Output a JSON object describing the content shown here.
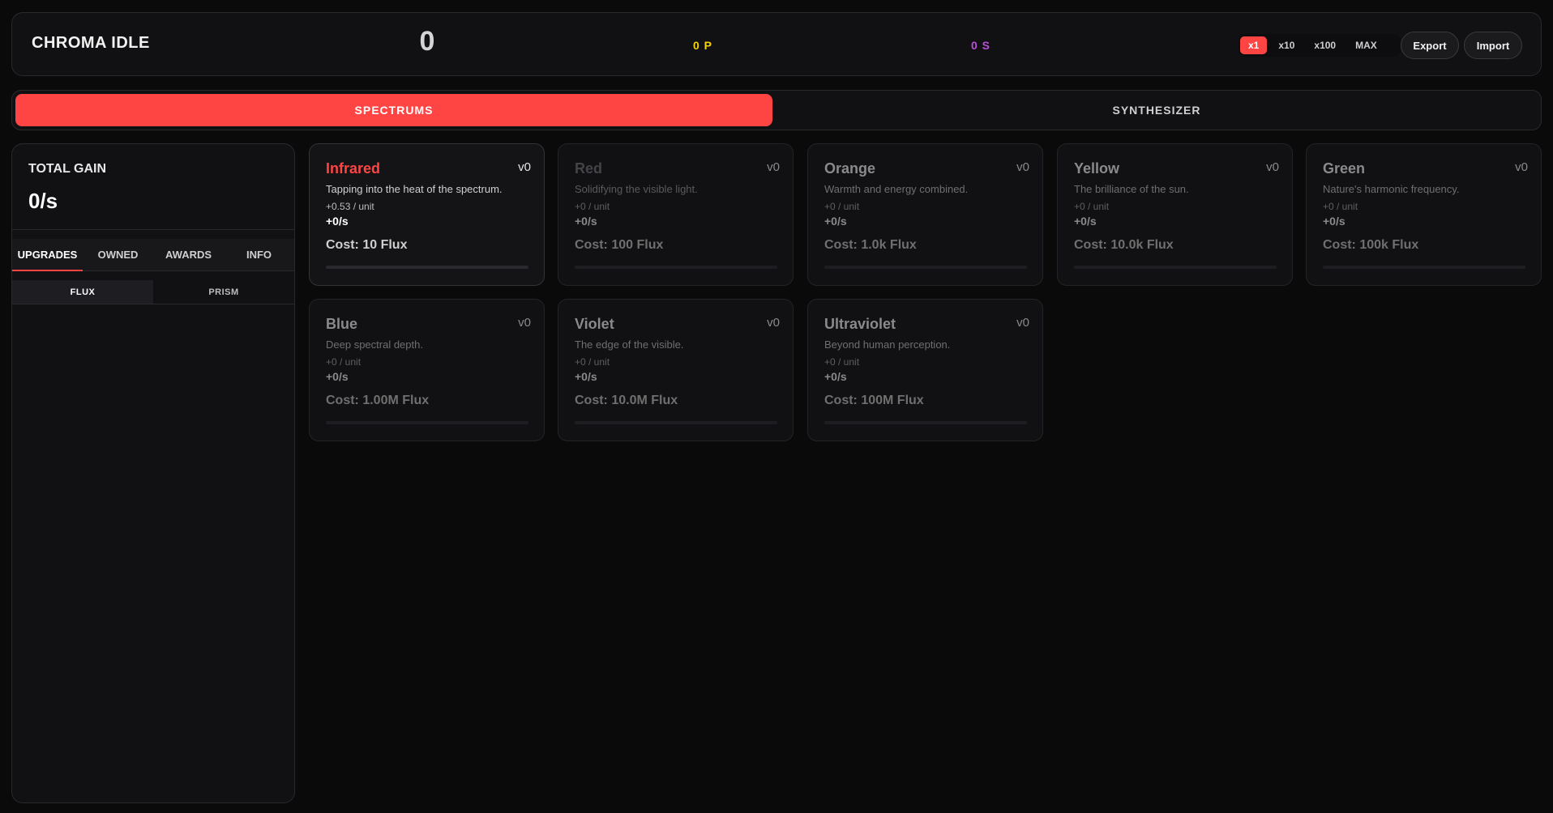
{
  "header": {
    "title": "CHROMA IDLE",
    "flux_count": "0",
    "prism_count": "0 P",
    "synth_count": "0 S",
    "multipliers": [
      {
        "label": "x1",
        "active": true
      },
      {
        "label": "x10",
        "active": false
      },
      {
        "label": "x100",
        "active": false
      },
      {
        "label": "MAX",
        "active": false
      }
    ],
    "export_label": "Export",
    "import_label": "Import"
  },
  "main_tabs": {
    "spectrums": "SPECTRUMS",
    "synthesizer": "SYNTHESIZER"
  },
  "sidebar": {
    "gain_label": "TOTAL GAIN",
    "gain_value": "0/s",
    "tabs": [
      "UPGRADES",
      "OWNED",
      "AWARDS",
      "INFO"
    ],
    "sub_tabs": [
      "FLUX",
      "PRISM"
    ]
  },
  "spectrums": [
    {
      "name": "Infrared",
      "level": "v0",
      "desc": "Tapping into the heat of the spectrum.",
      "unit": "+0.53 / unit",
      "rate": "+0/s",
      "cost": "Cost: 10 Flux",
      "progress": 0
    },
    {
      "name": "Red",
      "level": "v0",
      "desc": "Solidifying the visible light.",
      "unit": "+0 / unit",
      "rate": "+0/s",
      "cost": "Cost: 100 Flux",
      "progress": 0
    },
    {
      "name": "Orange",
      "level": "v0",
      "desc": "Warmth and energy combined.",
      "unit": "+0 / unit",
      "rate": "+0/s",
      "cost": "Cost: 1.0k Flux",
      "progress": 0
    },
    {
      "name": "Yellow",
      "level": "v0",
      "desc": "The brilliance of the sun.",
      "unit": "+0 / unit",
      "rate": "+0/s",
      "cost": "Cost: 10.0k Flux",
      "progress": 0
    },
    {
      "name": "Green",
      "level": "v0",
      "desc": "Nature's harmonic frequency.",
      "unit": "+0 / unit",
      "rate": "+0/s",
      "cost": "Cost: 100k Flux",
      "progress": 0
    },
    {
      "name": "Blue",
      "level": "v0",
      "desc": "Deep spectral depth.",
      "unit": "+0 / unit",
      "rate": "+0/s",
      "cost": "Cost: 1.00M Flux",
      "progress": 0
    },
    {
      "name": "Violet",
      "level": "v0",
      "desc": "The edge of the visible.",
      "unit": "+0 / unit",
      "rate": "+0/s",
      "cost": "Cost: 10.0M Flux",
      "progress": 0
    },
    {
      "name": "Ultraviolet",
      "level": "v0",
      "desc": "Beyond human perception.",
      "unit": "+0 / unit",
      "rate": "+0/s",
      "cost": "Cost: 100M Flux",
      "progress": 0
    }
  ]
}
